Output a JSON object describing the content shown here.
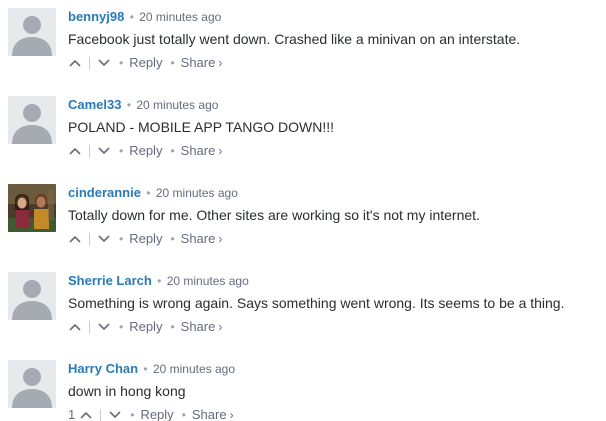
{
  "comments": [
    {
      "author": "bennyj98",
      "time": "20 minutes ago",
      "text": "Facebook just totally went down. Crashed like a minivan on an interstate.",
      "votes": "",
      "reply_label": "Reply",
      "share_label": "Share",
      "share_arrow": "›",
      "avatar": "default-avatar"
    },
    {
      "author": "Camel33",
      "time": "20 minutes ago",
      "text": "POLAND - MOBILE APP TANGO DOWN!!!",
      "votes": "",
      "reply_label": "Reply",
      "share_label": "Share",
      "share_arrow": "›",
      "avatar": "default-avatar"
    },
    {
      "author": "cinderannie",
      "time": "20 minutes ago",
      "text": "Totally down for me. Other sites are working so it's not my internet.",
      "votes": "",
      "reply_label": "Reply",
      "share_label": "Share",
      "share_arrow": "›",
      "avatar": "photo-avatar"
    },
    {
      "author": "Sherrie Larch",
      "time": "20 minutes ago",
      "text": "Something is wrong again. Says something went wrong. Its seems to be a thing.",
      "votes": "",
      "reply_label": "Reply",
      "share_label": "Share",
      "share_arrow": "›",
      "avatar": "default-avatar"
    },
    {
      "author": "Harry Chan",
      "time": "20 minutes ago",
      "text": "down in hong kong",
      "votes": "1",
      "reply_label": "Reply",
      "share_label": "Share",
      "share_arrow": "›",
      "avatar": "default-avatar"
    }
  ],
  "colors": {
    "author": "#2a7ab8",
    "meta": "#656c7a",
    "body": "#2a2e2e",
    "avatar_bg": "#e7eaed",
    "avatar_fg": "#a4abb3"
  }
}
